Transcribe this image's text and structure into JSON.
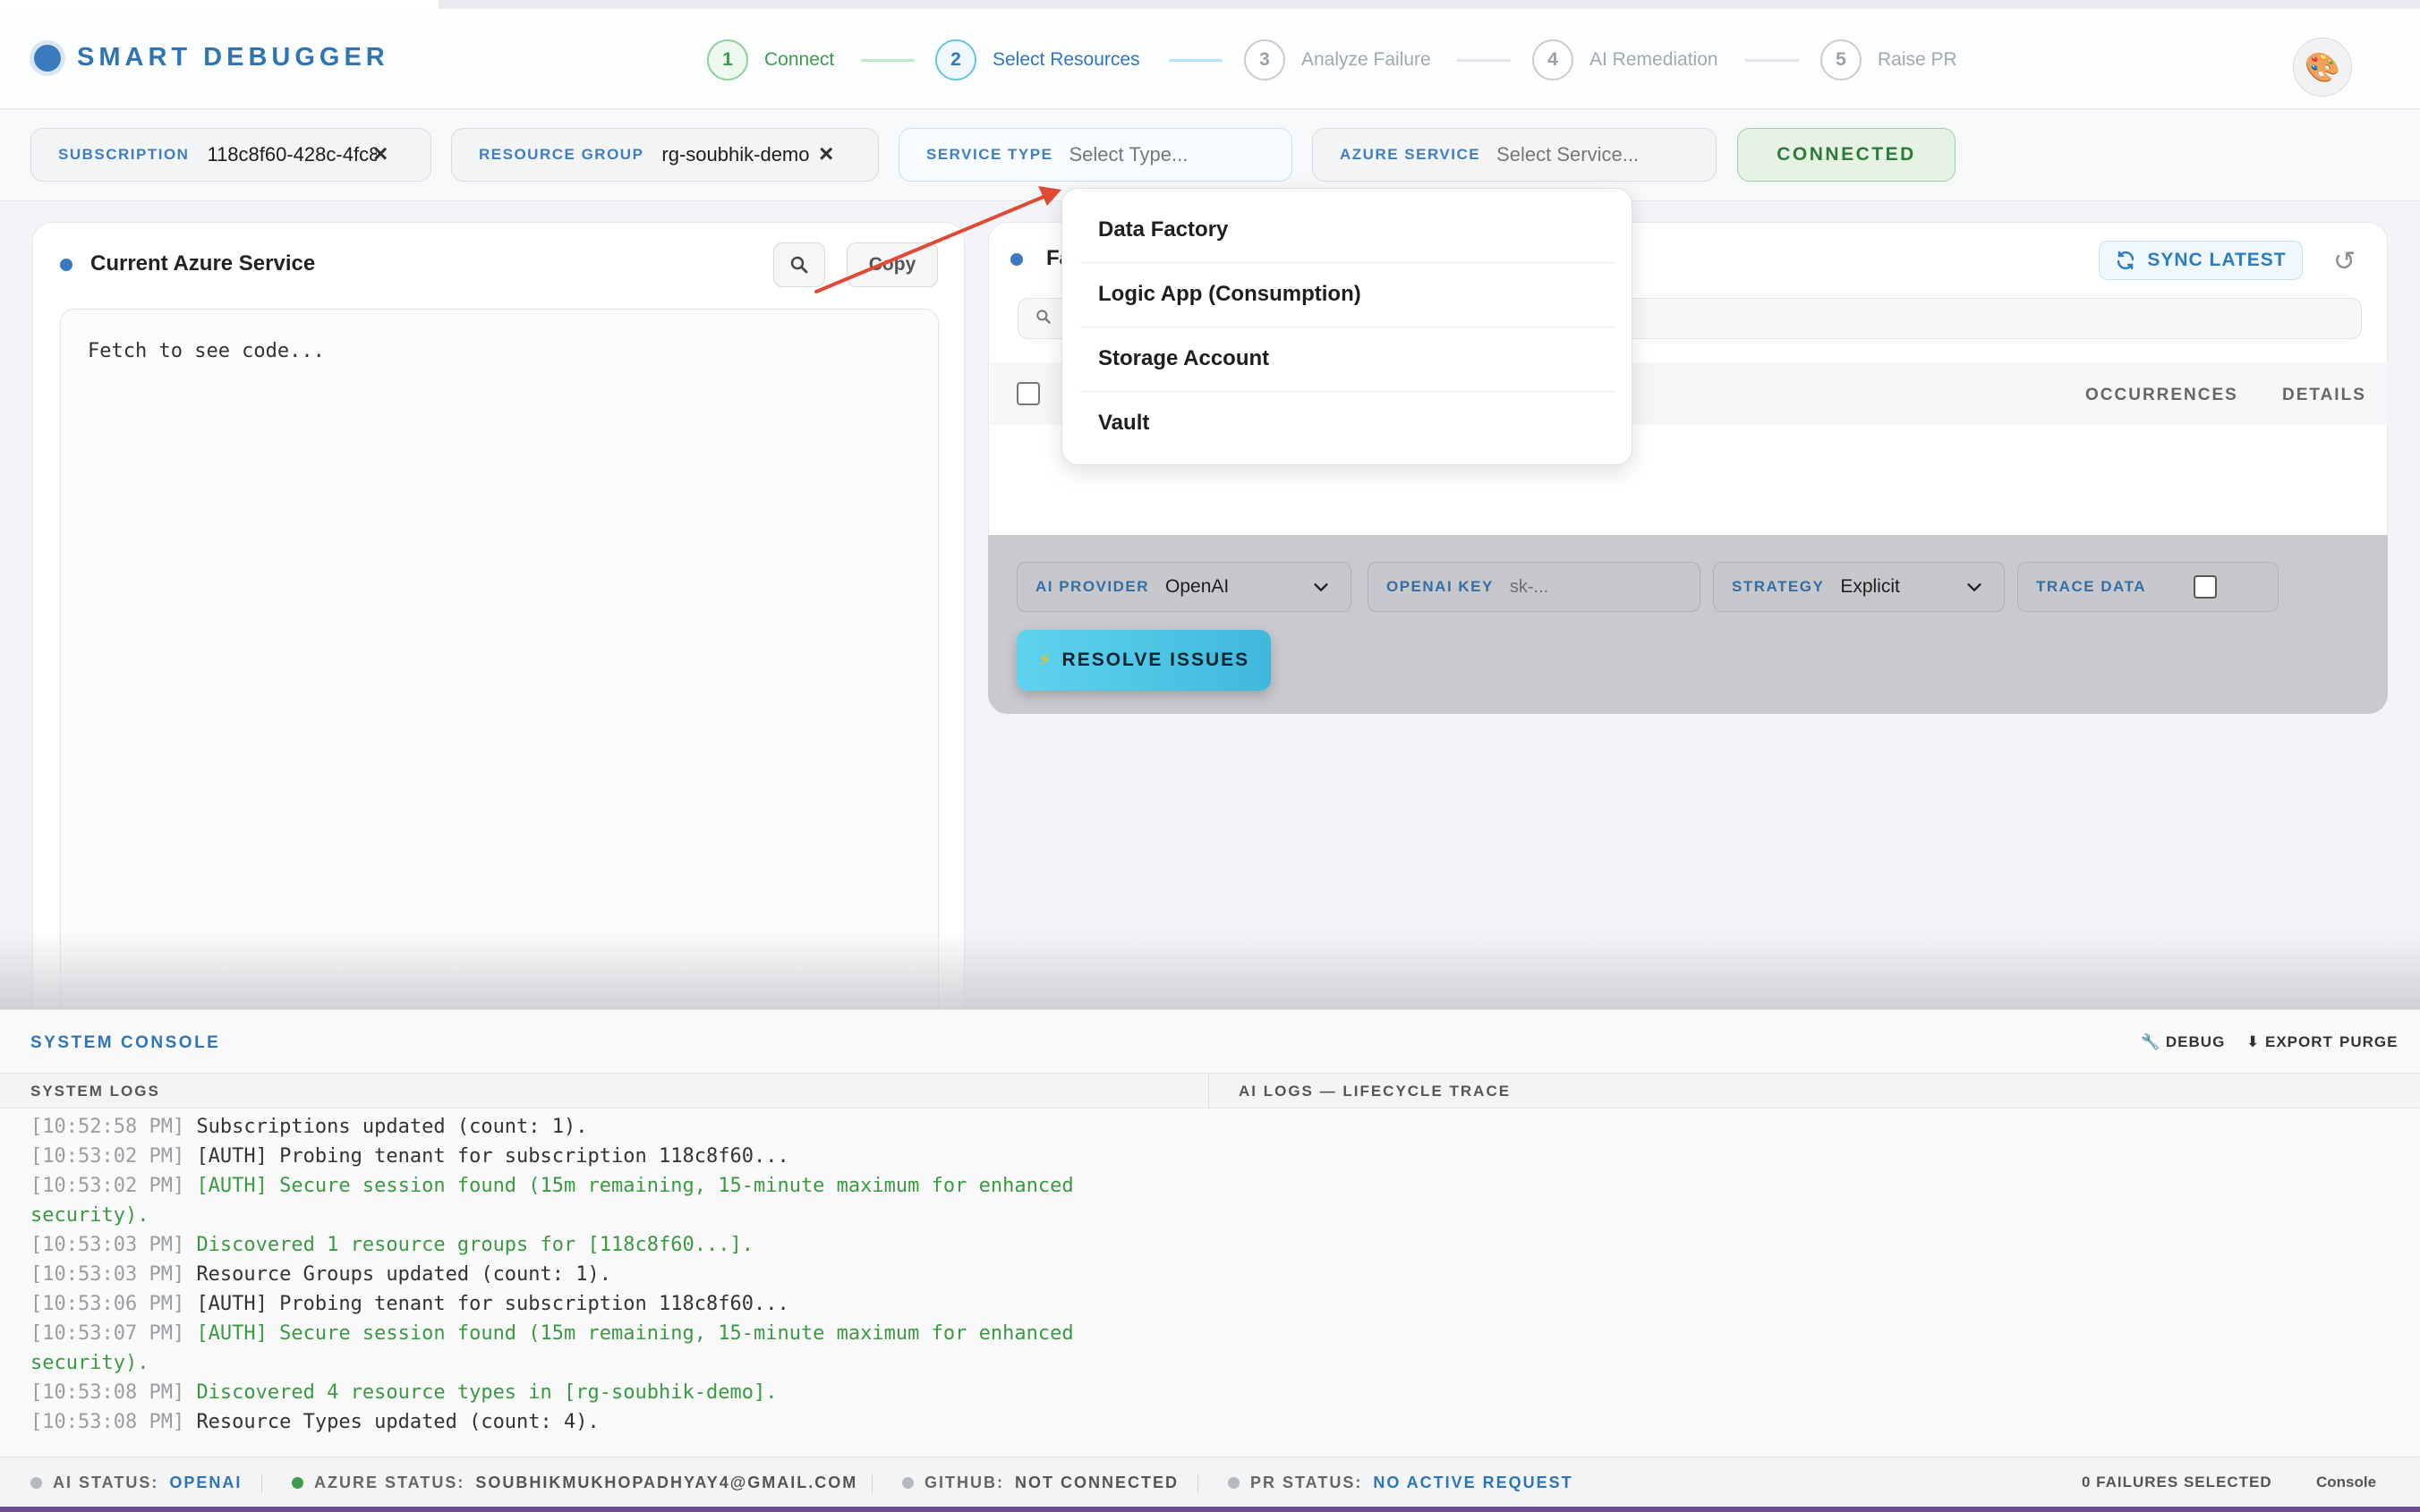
{
  "app": {
    "title": "SMART DEBUGGER",
    "avatar_icon": "🎨"
  },
  "steps": [
    {
      "num": "1",
      "label": "Connect",
      "state": "done"
    },
    {
      "num": "2",
      "label": "Select Resources",
      "state": "active"
    },
    {
      "num": "3",
      "label": "Analyze Failure",
      "state": "pending"
    },
    {
      "num": "4",
      "label": "AI Remediation",
      "state": "pending"
    },
    {
      "num": "5",
      "label": "Raise PR",
      "state": "pending"
    }
  ],
  "filters": {
    "subscription": {
      "label": "SUBSCRIPTION",
      "value": "118c8f60-428c-4fc8"
    },
    "resource_group": {
      "label": "RESOURCE GROUP",
      "value": "rg-soubhik-demo"
    },
    "service_type": {
      "label": "SERVICE TYPE",
      "placeholder": "Select Type..."
    },
    "azure_service": {
      "label": "AZURE SERVICE",
      "placeholder": "Select Service..."
    },
    "connected_label": "CONNECTED"
  },
  "left_panel": {
    "title": "Current Azure Service",
    "copy_label": "Copy",
    "code_placeholder": "Fetch to see code..."
  },
  "right_panel": {
    "title_partial": "Fa",
    "sync_label": "SYNC LATEST",
    "columns": {
      "occurrences": "OCCURRENCES",
      "details": "DETAILS"
    }
  },
  "dropdown": {
    "options": [
      "Data Factory",
      "Logic App (Consumption)",
      "Storage Account",
      "Vault"
    ]
  },
  "controls": {
    "ai_provider": {
      "label": "AI PROVIDER",
      "value": "OpenAI"
    },
    "openai_key": {
      "label": "OPENAI KEY",
      "placeholder": "sk-..."
    },
    "strategy": {
      "label": "STRATEGY",
      "value": "Explicit"
    },
    "trace_data": {
      "label": "TRACE DATA"
    },
    "resolve_label": "RESOLVE ISSUES"
  },
  "console": {
    "title": "SYSTEM CONSOLE",
    "debug_label": "DEBUG",
    "export_label": "EXPORT",
    "purge_label": "PURGE",
    "system_logs_label": "SYSTEM LOGS",
    "ai_logs_label": "AI LOGS — LIFECYCLE TRACE",
    "logs": [
      {
        "ts": "[10:52:58 PM]",
        "msg": "Subscriptions updated (count: 1).",
        "kind": "gray"
      },
      {
        "ts": "[10:53:02 PM]",
        "msg": "[AUTH] Probing tenant for subscription 118c8f60...",
        "kind": "gray"
      },
      {
        "ts": "[10:53:02 PM]",
        "msg": "[AUTH] Secure session found (15m remaining, 15-minute maximum for enhanced security).",
        "kind": "green"
      },
      {
        "ts": "[10:53:03 PM]",
        "msg": "Discovered 1 resource groups for [118c8f60...].",
        "kind": "green"
      },
      {
        "ts": "[10:53:03 PM]",
        "msg": "Resource Groups updated (count: 1).",
        "kind": "gray"
      },
      {
        "ts": "[10:53:06 PM]",
        "msg": "[AUTH] Probing tenant for subscription 118c8f60...",
        "kind": "gray"
      },
      {
        "ts": "[10:53:07 PM]",
        "msg": "[AUTH] Secure session found (15m remaining, 15-minute maximum for enhanced security).",
        "kind": "green"
      },
      {
        "ts": "[10:53:08 PM]",
        "msg": "Discovered 4 resource types in [rg-soubhik-demo].",
        "kind": "green"
      },
      {
        "ts": "[10:53:08 PM]",
        "msg": "Resource Types updated (count: 4).",
        "kind": "gray"
      }
    ]
  },
  "status_bar": {
    "ai_status": {
      "key": "AI STATUS:",
      "value": "OPENAI",
      "dot_color": "#b5b8bc"
    },
    "azure_status": {
      "key": "AZURE STATUS:",
      "value": "SOUBHIKMUKHOPADHYAY4@GMAIL.COM",
      "dot_color": "#3d9b4e"
    },
    "github": {
      "key": "GITHUB:",
      "value": "NOT CONNECTED",
      "dot_color": "#b5b8bc"
    },
    "pr_status": {
      "key": "PR STATUS:",
      "value": "NO ACTIVE REQUEST",
      "dot_color": "#b5b8bc"
    },
    "failures_selected": "0 FAILURES SELECTED",
    "console_label": "Console"
  },
  "colors": {
    "accent": "#2f74b5",
    "success": "#3d9b4e",
    "arrow": "#e04a35",
    "frame": "#6c4d8f"
  }
}
